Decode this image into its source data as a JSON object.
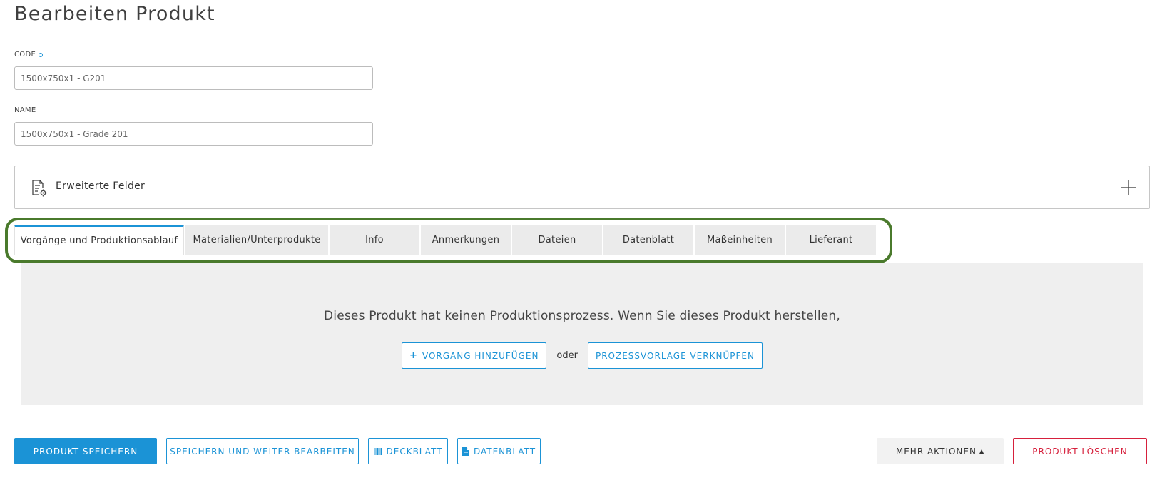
{
  "page": {
    "title": "Bearbeiten Produkt"
  },
  "form": {
    "code": {
      "label": "CODE",
      "value": "1500x750x1 - G201"
    },
    "name": {
      "label": "NAME",
      "value": "1500x750x1 - Grade 201"
    }
  },
  "extended_fields": {
    "title": "Erweiterte Felder",
    "icon": "document-settings-icon",
    "toggle_icon": "plus-icon"
  },
  "tabs": [
    {
      "label": "Vorgänge und Produktionsablauf",
      "active": true
    },
    {
      "label": "Materialien/Unterprodukte",
      "active": false
    },
    {
      "label": "Info",
      "active": false
    },
    {
      "label": "Anmerkungen",
      "active": false
    },
    {
      "label": "Dateien",
      "active": false
    },
    {
      "label": "Datenblatt",
      "active": false
    },
    {
      "label": "Maßeinheiten",
      "active": false
    },
    {
      "label": "Lieferant",
      "active": false
    }
  ],
  "panel": {
    "message": "Dieses Produkt hat keinen Produktionsprozess. Wenn Sie dieses Produkt herstellen,",
    "add_operation_label": "VORGANG HINZUFÜGEN",
    "or_text": "oder",
    "link_template_label": "PROZESSVORLAGE VERKNÜPFEN"
  },
  "footer": {
    "save_label": "PRODUKT SPEICHERN",
    "save_continue_label": "SPEICHERN UND WEITER BEARBEITEN",
    "cover_sheet_label": "DECKBLATT",
    "datasheet_label": "DATENBLATT",
    "more_actions_label": "MEHR AKTIONEN",
    "delete_label": "PRODUKT LÖSCHEN"
  },
  "colors": {
    "accent": "#1b93d6",
    "danger": "#d6203c",
    "highlight": "#4a7a2c",
    "panel_bg": "#efefef"
  }
}
